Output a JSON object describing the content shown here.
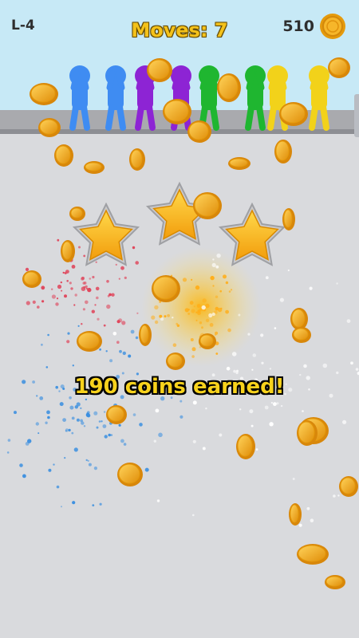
{
  "hud": {
    "level_label": "L-4",
    "moves_label": "Moves: 7",
    "coin_total": "510",
    "coin_icon": "coin-icon"
  },
  "result": {
    "stars_earned": 3,
    "stars_total": 3,
    "message": "190 coins earned!"
  },
  "characters": [
    {
      "color": "#3f8cf2"
    },
    {
      "color": "#3f8cf2"
    },
    {
      "color": "#8d24d4"
    },
    {
      "color": "#8d24d4"
    },
    {
      "color": "#1fb630"
    },
    {
      "color": "#1fb630"
    },
    {
      "color": "#f2d21a"
    },
    {
      "color": "#f2d21a"
    }
  ],
  "colors": {
    "sky": "#c7e9f6",
    "floor": "#d9dadd",
    "gold": "#f2b31c",
    "moves_text": "#f4c21a",
    "star_fill": "#f7bb1a",
    "star_rim": "#c9c9cc"
  }
}
